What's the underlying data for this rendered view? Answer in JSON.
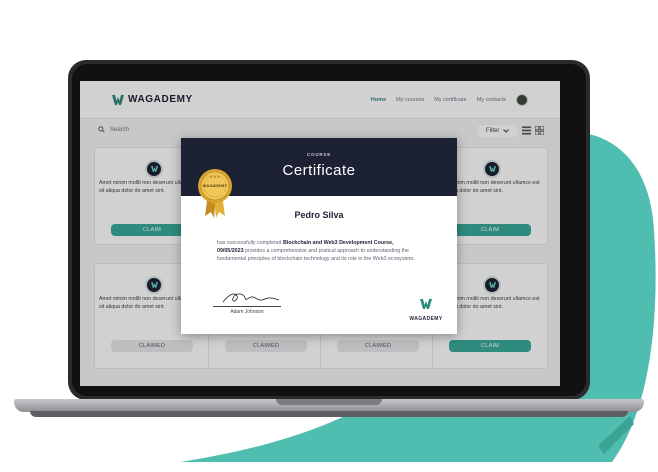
{
  "app": {
    "logo_text": "WAGADEMY",
    "nav": [
      "Home",
      "My courses",
      "My certificate",
      "My contacts"
    ]
  },
  "toolbar": {
    "search_label": "Search",
    "filter_label": "Filter"
  },
  "cards": [
    {
      "text": "Amet minim mollit non deserunt ullamco est sit aliqua dolor do amet sint.",
      "button": "CLAIM",
      "state": "claim"
    },
    {
      "text": "Amet minim mollit non deserunt ullamco est sit aliqua dolor do amet sint.",
      "button": "CLAIM",
      "state": "claim"
    },
    {
      "text": "Amet minim mollit non deserunt ullamco est sit aliqua dolor do amet sint.",
      "button": "CLAIMED",
      "state": "claimed"
    },
    {
      "text": "Amet minim mollit non deserunt ullamco est sit aliqua dolor do amet sint.",
      "button": "CLAIMED",
      "state": "claimed"
    },
    {
      "text": "Amet minim mollit non deserunt ullamco est sit aliqua dolor do amet sint.",
      "button": "CLAIMED",
      "state": "claimed"
    },
    {
      "text": "Amet minim mollit non deserunt ullamco est sit aliqua dolor do amet sint.",
      "button": "CLAIM",
      "state": "claim"
    }
  ],
  "certificate": {
    "kicker": "COURSE",
    "title": "Certificate",
    "name": "Pedro Silva",
    "desc_prefix": "has successfully completed ",
    "course_name": "Blockchain and Web3 Development Course",
    "date": "09/05/2023",
    "desc_suffix": " provides a comprehensive and pratical approach to understanding the fundamental principles of blockchain technology and its role in the Web3 ecosystem.",
    "signer": "Adam Johnson",
    "logo_text": "WAGADEMY",
    "medal_text": "WAGADEMY"
  },
  "colors": {
    "accent": "#3aaa99",
    "navy": "#1d2134",
    "gold": "#e2b23c",
    "backdrop": "#4fbdb0"
  },
  "icons": [
    "search-icon",
    "chevron-down-icon",
    "list-view-icon",
    "grid-view-icon",
    "course-badge-icon",
    "wagademy-logo-icon",
    "gold-medal-icon",
    "signature-icon"
  ]
}
